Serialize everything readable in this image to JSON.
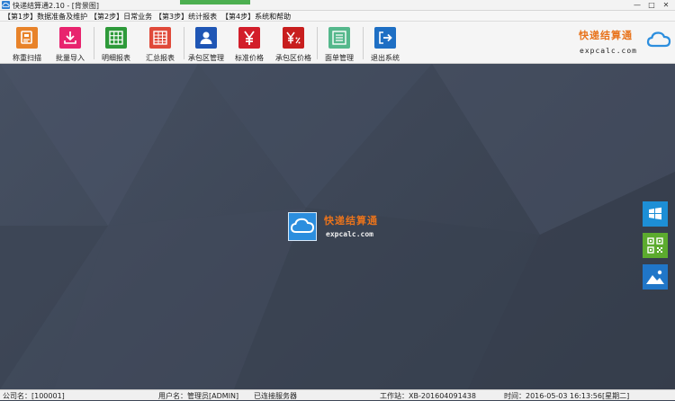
{
  "window": {
    "title": "快递结算通2.10 - [背景图]",
    "controls": {
      "minimize": "—",
      "maximize": "□",
      "close": "✕"
    }
  },
  "menu": {
    "items": [
      {
        "label": "【第1步】数据准备及维护"
      },
      {
        "label": "【第2步】日常业务"
      },
      {
        "label": "【第3步】统计报表"
      },
      {
        "label": "【第4步】系统和帮助"
      }
    ]
  },
  "toolbar": {
    "buttons": [
      {
        "label": "称重扫描",
        "icon": "scale-scan-icon",
        "color": "#e8832a"
      },
      {
        "label": "批量导入",
        "icon": "download-import-icon",
        "color": "#e8246e"
      },
      {
        "label": "明细报表",
        "icon": "detail-grid-icon",
        "color": "#2e9a3a"
      },
      {
        "label": "汇总报表",
        "icon": "summary-grid-icon",
        "color": "#e04a3a"
      },
      {
        "label": "承包区管理",
        "icon": "user-icon",
        "color": "#1f56b5"
      },
      {
        "label": "标准价格",
        "icon": "yen-icon",
        "color": "#d21e2a"
      },
      {
        "label": "承包区价格",
        "icon": "yen-percent-icon",
        "color": "#c81e1e"
      },
      {
        "label": "面单管理",
        "icon": "list-doc-icon",
        "color": "#55b88c"
      },
      {
        "label": "退出系统",
        "icon": "exit-arrow-icon",
        "color": "#1e6fc4"
      }
    ]
  },
  "brand": {
    "name": "快递结算通",
    "domain": "expcalc.com",
    "accent": "#e8731c",
    "icon": "cloud-icon"
  },
  "side_buttons": [
    {
      "icon": "windows-icon",
      "color": "#1d8fd6"
    },
    {
      "icon": "qr-code-icon",
      "color": "#5cab2e"
    },
    {
      "icon": "mountain-image-icon",
      "color": "#2076c8"
    }
  ],
  "status": {
    "company": "公司名：[100001]",
    "user": "用户名：管理员[ADMIN]",
    "connection": "已连接服务器",
    "workstation": "工作站：XB-201604091438",
    "time": "时间：2016-05-03 16:13:56[星期二]"
  }
}
